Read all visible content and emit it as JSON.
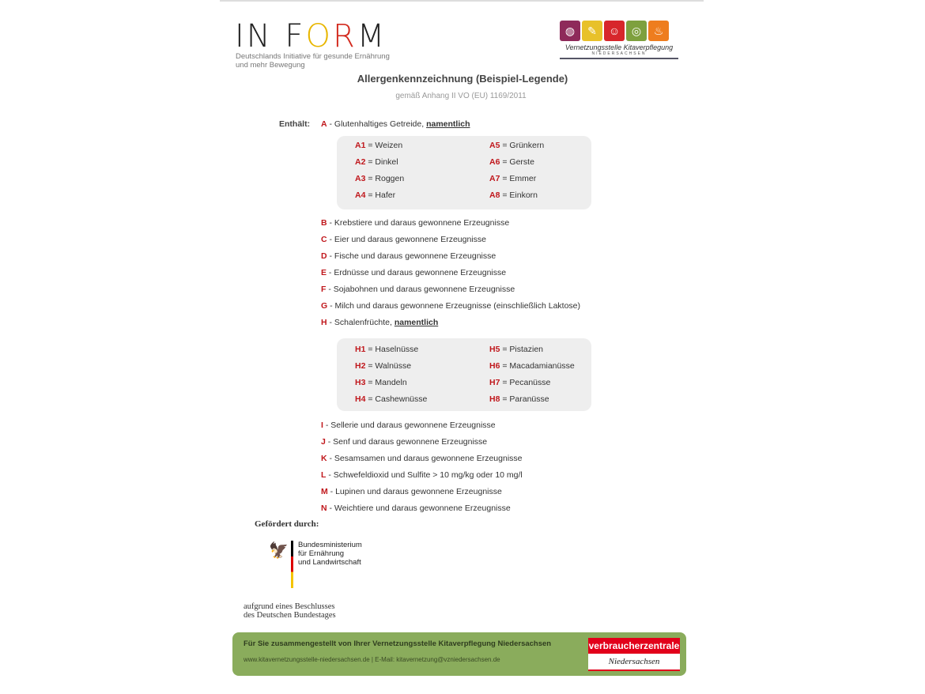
{
  "header": {
    "logo_text": "IN FORM",
    "logo_tagline_1": "Deutschlands Initiative für gesunde Ernährung",
    "logo_tagline_2": "und mehr Bewegung",
    "partner_logo_name": "Vernetzungsstelle Kitaverpflegung",
    "partner_logo_region": "NIEDERSACHSEN"
  },
  "title": "Allergenkennzeichnung (Beispiel-Legende)",
  "subtitle": "gemäß Anhang II VO (EU) 1169/2011",
  "contains_label": "Enthält:",
  "colors": {
    "code": "#c0171c",
    "footer": "#8aac5c",
    "box": "#eeeeee"
  },
  "groupA": {
    "code": "A",
    "text": " - Glutenhaltiges Getreide, ",
    "emph": "namentlich",
    "sub": [
      {
        "code": "A1",
        "text": " = Weizen"
      },
      {
        "code": "A5",
        "text": " = Grünkern"
      },
      {
        "code": "A2",
        "text": " = Dinkel"
      },
      {
        "code": "A6",
        "text": " = Gerste"
      },
      {
        "code": "A3",
        "text": " = Roggen"
      },
      {
        "code": "A7",
        "text": " = Emmer"
      },
      {
        "code": "A4",
        "text": " = Hafer"
      },
      {
        "code": "A8",
        "text": " = Einkorn"
      }
    ]
  },
  "items1": [
    {
      "code": "B",
      "text": " - Krebstiere und daraus gewonnene Erzeugnisse"
    },
    {
      "code": "C",
      "text": " - Eier und daraus gewonnene Erzeugnisse"
    },
    {
      "code": "D",
      "text": " - Fische und daraus gewonnene Erzeugnisse"
    },
    {
      "code": "E",
      "text": " - Erdnüsse und daraus gewonnene Erzeugnisse"
    },
    {
      "code": "F",
      "text": " - Sojabohnen und daraus gewonnene Erzeugnisse"
    },
    {
      "code": "G",
      "text": " - Milch und daraus gewonnene Erzeugnisse (einschließlich Laktose)"
    }
  ],
  "groupH": {
    "code": "H",
    "text": " - Schalenfrüchte, ",
    "emph": "namentlich",
    "sub": [
      {
        "code": "H1",
        "text": " = Haselnüsse"
      },
      {
        "code": "H5",
        "text": " = Pistazien"
      },
      {
        "code": "H2",
        "text": " = Walnüsse"
      },
      {
        "code": "H6",
        "text": " = Macadamianüsse"
      },
      {
        "code": "H3",
        "text": " = Mandeln"
      },
      {
        "code": "H7",
        "text": " = Pecanüsse"
      },
      {
        "code": "H4",
        "text": " = Cashewnüsse"
      },
      {
        "code": "H8",
        "text": " = Paranüsse"
      }
    ]
  },
  "items2": [
    {
      "code": "I",
      "text": " - Sellerie und daraus gewonnene Erzeugnisse"
    },
    {
      "code": "J",
      "text": " - Senf und daraus gewonnene Erzeugnisse"
    },
    {
      "code": "K",
      "text": " - Sesamsamen und daraus gewonnene Erzeugnisse"
    },
    {
      "code": "L",
      "text": " - Schwefeldioxid und Sulfite > 10 mg/kg oder 10 mg/l"
    },
    {
      "code": "M",
      "text": " - Lupinen und daraus gewonnene Erzeugnisse"
    },
    {
      "code": "N",
      "text": " - Weichtiere und daraus gewonnene Erzeugnisse"
    }
  ],
  "funding": {
    "label": "Gefördert durch:",
    "ministry": [
      "Bundesministerium",
      "für Ernährung",
      "und Landwirtschaft"
    ],
    "decision_1": "aufgrund eines Beschlusses",
    "decision_2": "des Deutschen Bundestages"
  },
  "footer": {
    "line1": "Für Sie zusammengestellt von Ihrer Vernetzungsstelle Kitaverpflegung Niedersachsen",
    "line2": "www.kitavernetzungsstelle-niedersachsen.de | E-Mail: kitavernetzung@vzniedersachsen.de",
    "vz_top": "verbraucherzentrale",
    "vz_bottom": "Niedersachsen"
  }
}
